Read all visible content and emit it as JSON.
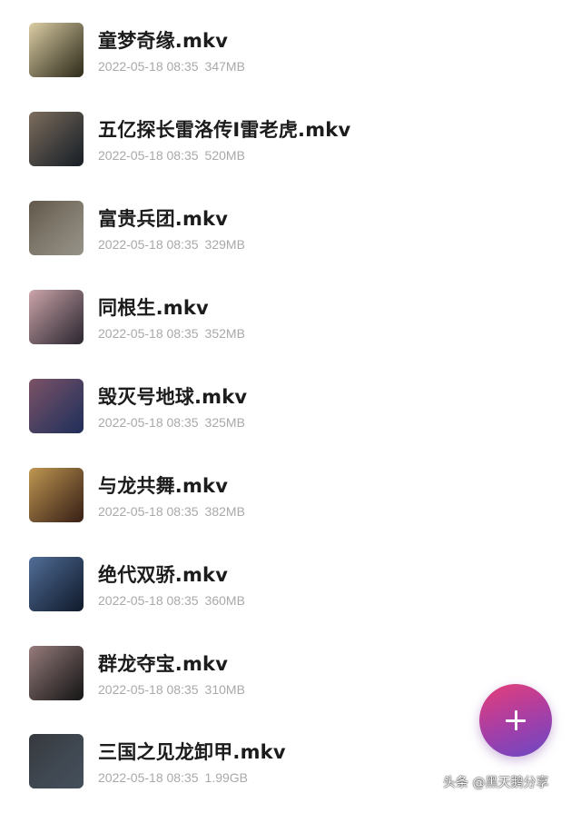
{
  "files": [
    {
      "name": "童梦奇缘.mkv",
      "date": "2022-05-18 08:35",
      "size": "347MB",
      "thumb_colors": [
        "#d9c99a",
        "#3e3a23"
      ]
    },
    {
      "name": "五亿探长雷洛传Ⅰ雷老虎.mkv",
      "date": "2022-05-18 08:35",
      "size": "520MB",
      "thumb_colors": [
        "#6c5a47",
        "#1e2832"
      ]
    },
    {
      "name": "富贵兵团.mkv",
      "date": "2022-05-18 08:35",
      "size": "329MB",
      "thumb_colors": [
        "#4a4030",
        "#c8c2b4"
      ]
    },
    {
      "name": "同根生.mkv",
      "date": "2022-05-18 08:35",
      "size": "352MB",
      "thumb_colors": [
        "#c79aa0",
        "#3a3340"
      ]
    },
    {
      "name": "毁灭号地球.mkv",
      "date": "2022-05-18 08:35",
      "size": "325MB",
      "thumb_colors": [
        "#6a3a50",
        "#2a3e78"
      ]
    },
    {
      "name": "与龙共舞.mkv",
      "date": "2022-05-18 08:35",
      "size": "382MB",
      "thumb_colors": [
        "#b88a3a",
        "#4a2a1c"
      ]
    },
    {
      "name": "绝代双骄.mkv",
      "date": "2022-05-18 08:35",
      "size": "360MB",
      "thumb_colors": [
        "#3a5a8a",
        "#14223a"
      ]
    },
    {
      "name": "群龙夺宝.mkv",
      "date": "2022-05-18 08:35",
      "size": "310MB",
      "thumb_colors": [
        "#8a6a6a",
        "#1c1c1c"
      ]
    },
    {
      "name": "三国之见龙卸甲.mkv",
      "date": "2022-05-18 08:35",
      "size": "1.99GB",
      "thumb_colors": [
        "#1a1c22",
        "#5a6a7a"
      ]
    }
  ],
  "fab": {
    "icon": "plus-icon",
    "gradient": [
      "#e63d78",
      "#6a48c4"
    ]
  },
  "watermark": "头条 @黑天鹅分享"
}
